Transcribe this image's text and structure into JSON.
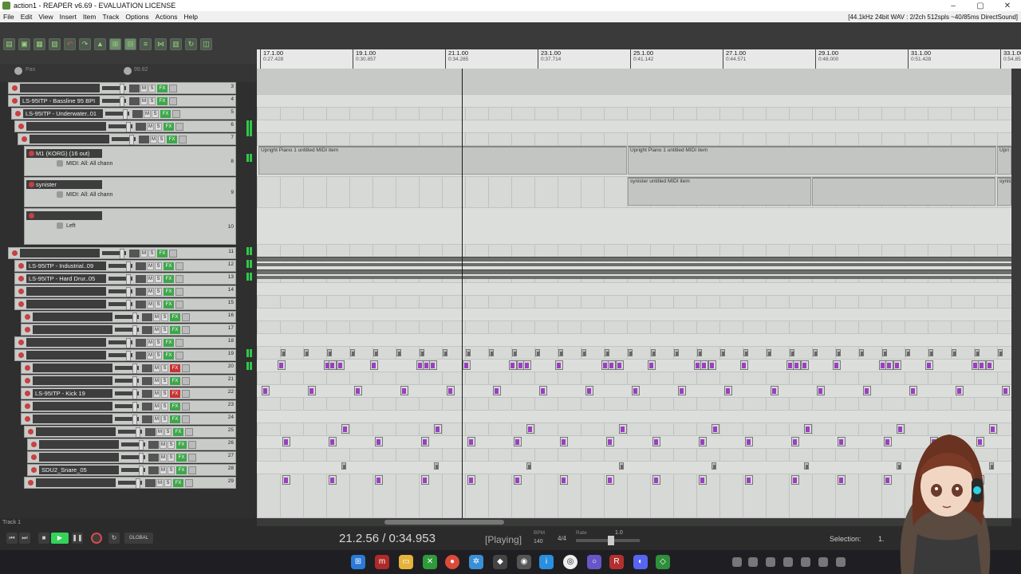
{
  "window": {
    "title": "action1 - REAPER v6.69 - EVALUATION LICENSE",
    "controls": [
      "–",
      "▢",
      "✕"
    ]
  },
  "menu": {
    "items": [
      "File",
      "Edit",
      "View",
      "Insert",
      "Item",
      "Track",
      "Options",
      "Actions",
      "Help"
    ],
    "audio_status": "[44.1kHz 24bit WAV : 2/2ch 512spls ~40/85ms DirectSound]"
  },
  "tcp_header": {
    "left_label": "Pan",
    "right_label": "99.82"
  },
  "tracks": [
    {
      "num": "3",
      "name": "",
      "fx": "on"
    },
    {
      "num": "4",
      "name": "LS-95ITP - Bassline 95 BPI",
      "fx": "on"
    },
    {
      "num": "5",
      "name": "LS-95ITP - Underwater..01",
      "fx": "on"
    },
    {
      "num": "6",
      "name": "",
      "fx": "on"
    },
    {
      "num": "7",
      "name": "",
      "fx": "on"
    },
    {
      "num": "11",
      "name": "",
      "fx": "on"
    },
    {
      "num": "12",
      "name": "LS-95ITP - Industrial..09",
      "fx": "on"
    },
    {
      "num": "13",
      "name": "LS-95ITP - Hard Drur..05",
      "fx": "on"
    },
    {
      "num": "14",
      "name": "",
      "fx": "on"
    },
    {
      "num": "15",
      "name": "",
      "fx": "on"
    },
    {
      "num": "16",
      "name": "",
      "fx": "on"
    },
    {
      "num": "17",
      "name": "",
      "fx": "on"
    },
    {
      "num": "18",
      "name": "",
      "fx": "on"
    },
    {
      "num": "19",
      "name": "",
      "fx": "on"
    },
    {
      "num": "20",
      "name": "",
      "fx": "red"
    },
    {
      "num": "21",
      "name": "",
      "fx": "on"
    },
    {
      "num": "22",
      "name": "LS-95ITP - Kick 19",
      "fx": "red"
    },
    {
      "num": "23",
      "name": "",
      "fx": "on"
    },
    {
      "num": "24",
      "name": "",
      "fx": "on"
    },
    {
      "num": "25",
      "name": "",
      "fx": "on"
    },
    {
      "num": "26",
      "name": "",
      "fx": "on"
    },
    {
      "num": "27",
      "name": "",
      "fx": "on"
    },
    {
      "num": "28",
      "name": "SDU2_Snare_05",
      "fx": "on"
    },
    {
      "num": "29",
      "name": "",
      "fx": "on"
    }
  ],
  "big_tracks": [
    {
      "num": "8",
      "name": "M1 (KORG) (16 out)",
      "midi": "MIDI: All: All chann"
    },
    {
      "num": "9",
      "name": "synister",
      "midi": "MIDI: All: All chann"
    },
    {
      "num": "10",
      "name": "",
      "midi": "Left"
    }
  ],
  "ruler": [
    {
      "bar": "17.1.00",
      "time": "0:27.428"
    },
    {
      "bar": "19.1.00",
      "time": "0:30.857"
    },
    {
      "bar": "21.1.00",
      "time": "0:34.285"
    },
    {
      "bar": "23.1.00",
      "time": "0:37.714"
    },
    {
      "bar": "25.1.00",
      "time": "0:41.142"
    },
    {
      "bar": "27.1.00",
      "time": "0:44.571"
    },
    {
      "bar": "29.1.00",
      "time": "0:48.000"
    },
    {
      "bar": "31.1.00",
      "time": "0:51.428"
    },
    {
      "bar": "33.1.00",
      "time": "0:54.857"
    }
  ],
  "items": {
    "piano1": "Upright Piano 1 untitled MIDI item",
    "piano2": "Upright Piano 1 untitled MIDI item",
    "piano3": "Upri",
    "synister1": "synister untitled MIDI item",
    "synister2": "synis"
  },
  "status_left": "Track 1",
  "transport": {
    "time": "21.2.56 / 0:34.953",
    "state": "[Playing]",
    "bpm_label": "BPM",
    "bpm": "140",
    "signature": "4/4",
    "rate_label": "Rate",
    "rate": "1.0",
    "selection_label": "Selection:",
    "selection_value": "1."
  },
  "colors": {
    "accent_green": "#35d35a",
    "record_red": "#d84b4b",
    "midi_purple": "#9a3fc2"
  }
}
